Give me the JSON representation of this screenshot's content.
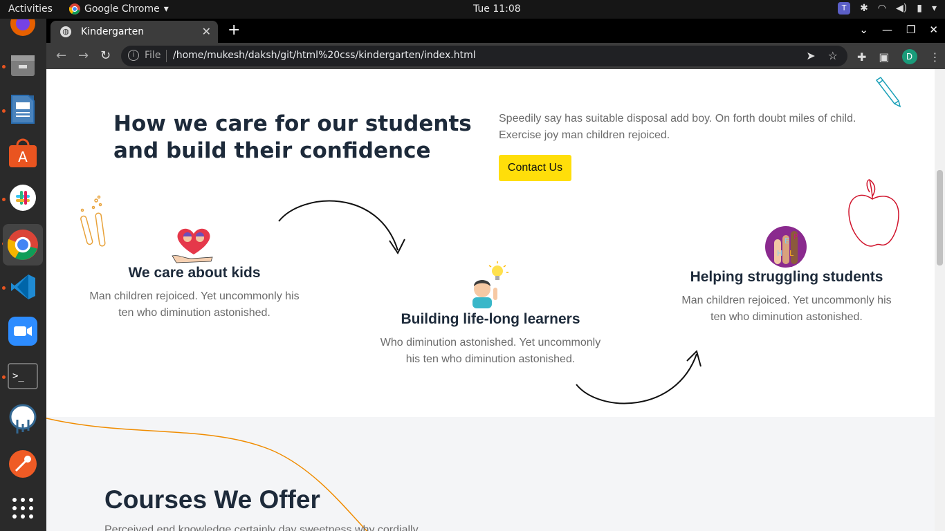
{
  "system": {
    "activities": "Activities",
    "app_name": "Google Chrome",
    "clock": "Tue 11:08"
  },
  "browser": {
    "tab_title": "Kindergarten",
    "address_label": "File",
    "url": "/home/mukesh/daksh/git/html%20css/kindergarten/index.html",
    "profile_initial": "D"
  },
  "hero": {
    "title": "How we care for our students and build their confidence",
    "intro": "Speedily say has suitable disposal add boy. On forth doubt miles of child. Exercise joy man children rejoiced.",
    "cta_label": "Contact Us"
  },
  "features": [
    {
      "title": "We care about kids",
      "text": "Man children rejoiced. Yet uncommonly his ten who diminution astonished."
    },
    {
      "title": "Building life-long learners",
      "text": "Who diminution astonished. Yet uncommonly his ten who diminution astonished."
    },
    {
      "title": "Helping struggling students",
      "text": "Man children rejoiced. Yet uncommonly his ten who diminution astonished."
    }
  ],
  "courses": {
    "title": "Courses We Offer",
    "subtitle": "Perceived end knowledge certainly day sweetness why cordially"
  },
  "colors": {
    "accent_yellow": "#ffde0a",
    "heading": "#1d2a3a",
    "body_text": "#6b6b6b",
    "section_bg": "#f4f5f7",
    "curve_orange": "#f08c00"
  }
}
